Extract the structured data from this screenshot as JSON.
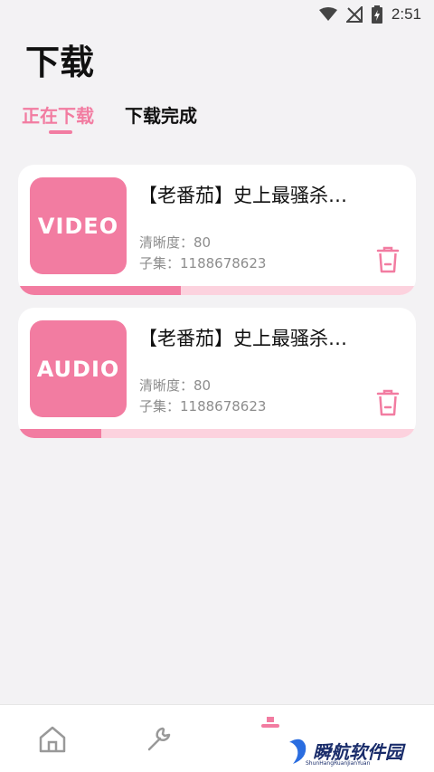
{
  "status": {
    "time": "2:51"
  },
  "page": {
    "title": "下载"
  },
  "tabs": [
    {
      "label": "正在下载",
      "active": true
    },
    {
      "label": "下载完成",
      "active": false
    }
  ],
  "downloads": [
    {
      "thumb_label": "VIDEO",
      "title": "【老番茄】史上最骚杀…",
      "quality": "清晰度：80",
      "episode": "子集：1188678623",
      "progress": 0.41
    },
    {
      "thumb_label": "AUDIO",
      "title": "【老番茄】史上最骚杀…",
      "quality": "清晰度：80",
      "episode": "子集：1188678623",
      "progress": 0.21
    }
  ],
  "nav": {
    "items": [
      {
        "icon": "home-icon"
      },
      {
        "icon": "wrench-icon"
      },
      {
        "icon": "download-icon"
      }
    ]
  },
  "watermark": {
    "text": "瞬航软件园",
    "sub": "ShunHangRuanJianYuan"
  },
  "colors": {
    "accent": "#f27ca1",
    "accent_light": "#fcd2de",
    "background": "#f3f2f4"
  }
}
